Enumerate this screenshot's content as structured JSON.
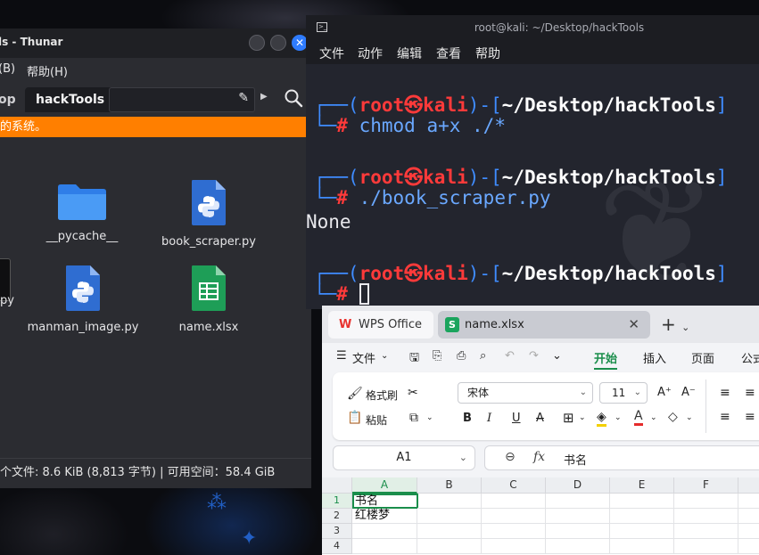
{
  "thunar": {
    "title": "ls - Thunar",
    "menu": [
      "(B)",
      "帮助(H)"
    ],
    "breadcrumb_prev": "op",
    "breadcrumb_current": "hackTools",
    "banner": "的系统。",
    "files": [
      {
        "name": "__pycache__",
        "kind": "folder"
      },
      {
        "name": "book_scraper.py",
        "kind": "python"
      },
      {
        "name": "manman_image.py",
        "kind": "python"
      },
      {
        "name": "name.xlsx",
        "kind": "spreadsheet"
      }
    ],
    "partial_item_label": "py",
    "status": "个文件: 8.6 KiB (8,813 字节) | 可用空间：58.4 GiB"
  },
  "terminal": {
    "title": "root@kali: ~/Desktop/hackTools",
    "menu": [
      "文件",
      "动作",
      "编辑",
      "查看",
      "帮助"
    ],
    "prompt": {
      "user": "root",
      "at": "㉿",
      "host": "kali",
      "path": "~/Desktop/hackTools",
      "symbol": "#"
    },
    "commands": [
      "chmod a+x ./*",
      "./book_scraper.py",
      ""
    ],
    "output": "None"
  },
  "wps": {
    "tab_home": "WPS Office",
    "tab_doc": "name.xlsx",
    "doc_badge": "S",
    "menu_file": "文件",
    "menu_tabs": [
      "开始",
      "插入",
      "页面",
      "公式"
    ],
    "active_tab": "开始",
    "ribbon": {
      "format_painter": "格式刷",
      "paste": "粘贴",
      "font_name": "宋体",
      "font_size": "11",
      "bold": "B",
      "italic": "I",
      "underline": "U"
    },
    "name_box": "A1",
    "formula_content": "书名",
    "columns": [
      "A",
      "B",
      "C",
      "D",
      "E",
      "F"
    ],
    "rows": [
      "1",
      "2",
      "3",
      "4"
    ],
    "cells": {
      "A1": "书名",
      "A2": "红楼梦"
    },
    "colors": {
      "accent": "#1a8e4b",
      "wps_red": "#e8332f"
    }
  },
  "colors": {
    "thunar_banner": "#ff7f00",
    "kali_blue": "#3f8cff",
    "kali_red": "#ff3a3a"
  }
}
